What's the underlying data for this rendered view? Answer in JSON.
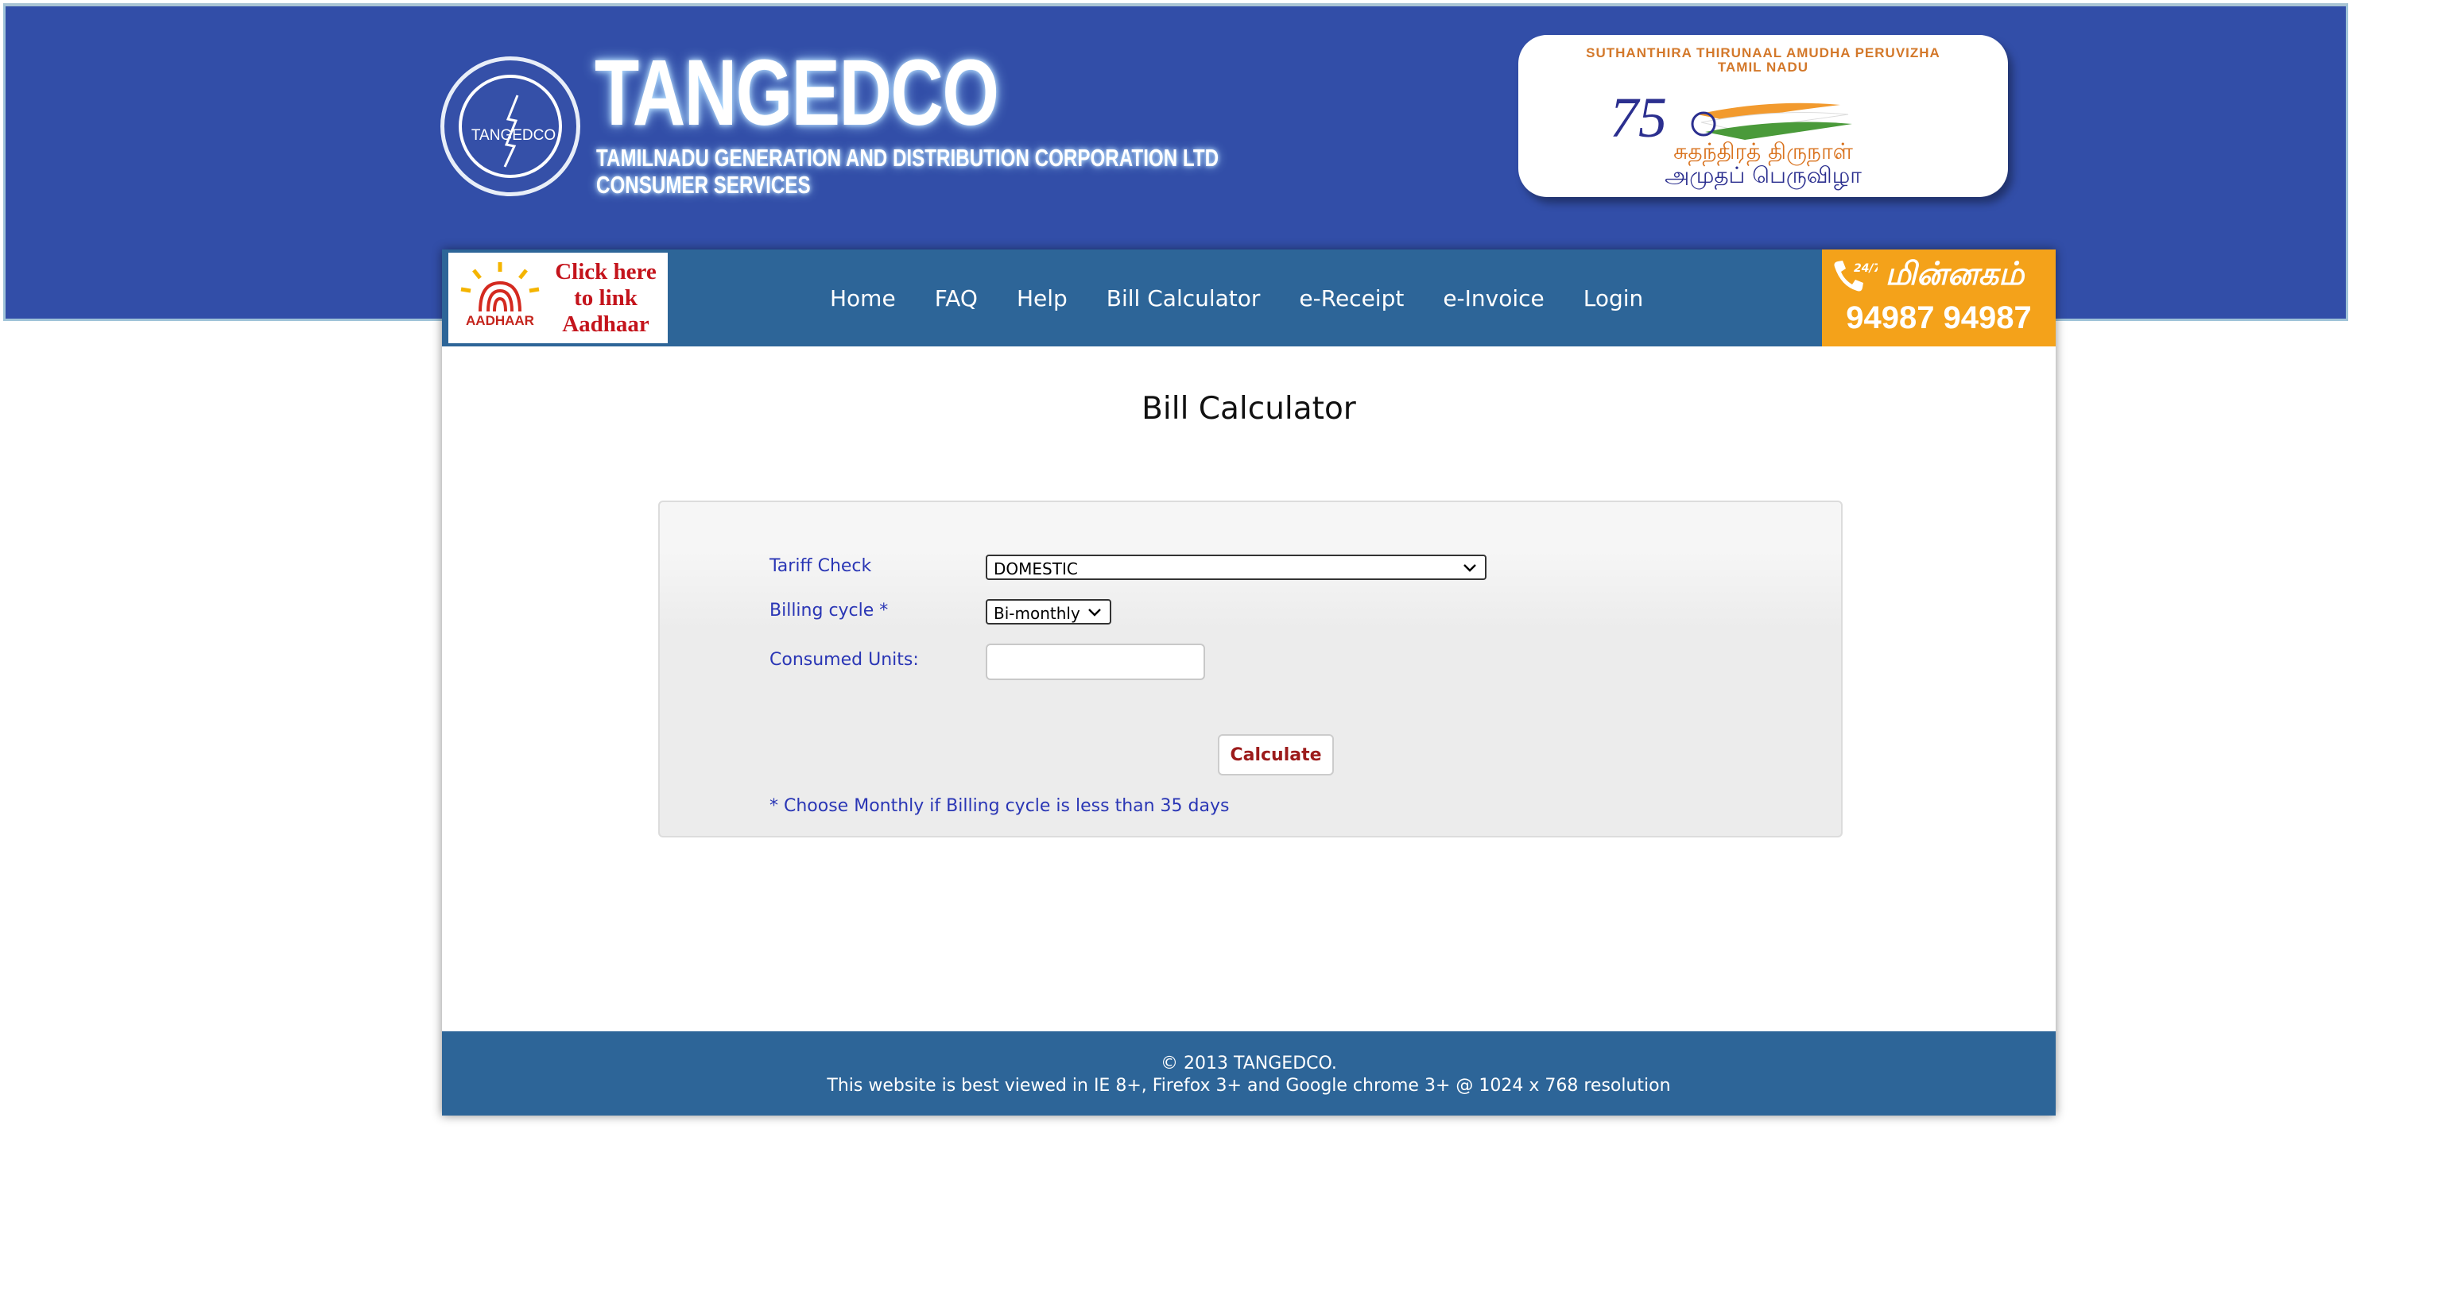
{
  "header": {
    "logo_ring_text": "TANGEDCO",
    "brand_title": "TANGEDCO",
    "brand_subtitle_line1": "TAMILNADU GENERATION AND DISTRIBUTION CORPORATION LTD",
    "brand_subtitle_line2": "CONSUMER SERVICES",
    "azadi_caption_line1": "SUTHANTHIRA THIRUNAAL  AMUDHA PERUVIZHA",
    "azadi_caption_line2": "TAMIL NADU",
    "azadi_number": "75",
    "azadi_tamil_line1": "சுதந்திரத் திருநாள்",
    "azadi_tamil_line2": "அமுதப் பெருவிழா"
  },
  "navbar": {
    "aadhaar_label": "AADHAAR",
    "aadhaar_cta_line1": "Click here",
    "aadhaar_cta_line2": "to link",
    "aadhaar_cta_line3": "Aadhaar",
    "links": [
      "Home",
      "FAQ",
      "Help",
      "Bill Calculator",
      "e-Receipt",
      "e-Invoice",
      "Login"
    ],
    "helpline_badge": "24/7",
    "helpline_title": "மின்னகம்",
    "helpline_number": "94987 94987"
  },
  "main": {
    "page_title": "Bill Calculator",
    "form": {
      "tariff_label": "Tariff Check",
      "tariff_value": "DOMESTIC",
      "billing_cycle_label": "Billing cycle *",
      "billing_cycle_value": "Bi-monthly",
      "consumed_units_label": "Consumed Units:",
      "consumed_units_value": "",
      "calculate_label": "Calculate",
      "note": "* Choose Monthly if Billing cycle is less than 35 days"
    }
  },
  "footer": {
    "copyright": "© 2013 TANGEDCO.",
    "best_viewed": "This website is best viewed in IE 8+, Firefox 3+ and Google chrome 3+ @ 1024 x 768 resolution"
  },
  "colors": {
    "banner_blue": "#324ea8",
    "nav_blue": "#2d6598",
    "helpline_orange": "#f4a21a",
    "label_blue": "#2a36b5",
    "button_red": "#9c1b1b"
  },
  "icons": [
    "tangedco-logo-icon",
    "aadhaar-sun-icon",
    "phone-icon",
    "chevron-down-icon",
    "azadi-75-emblem-icon"
  ]
}
